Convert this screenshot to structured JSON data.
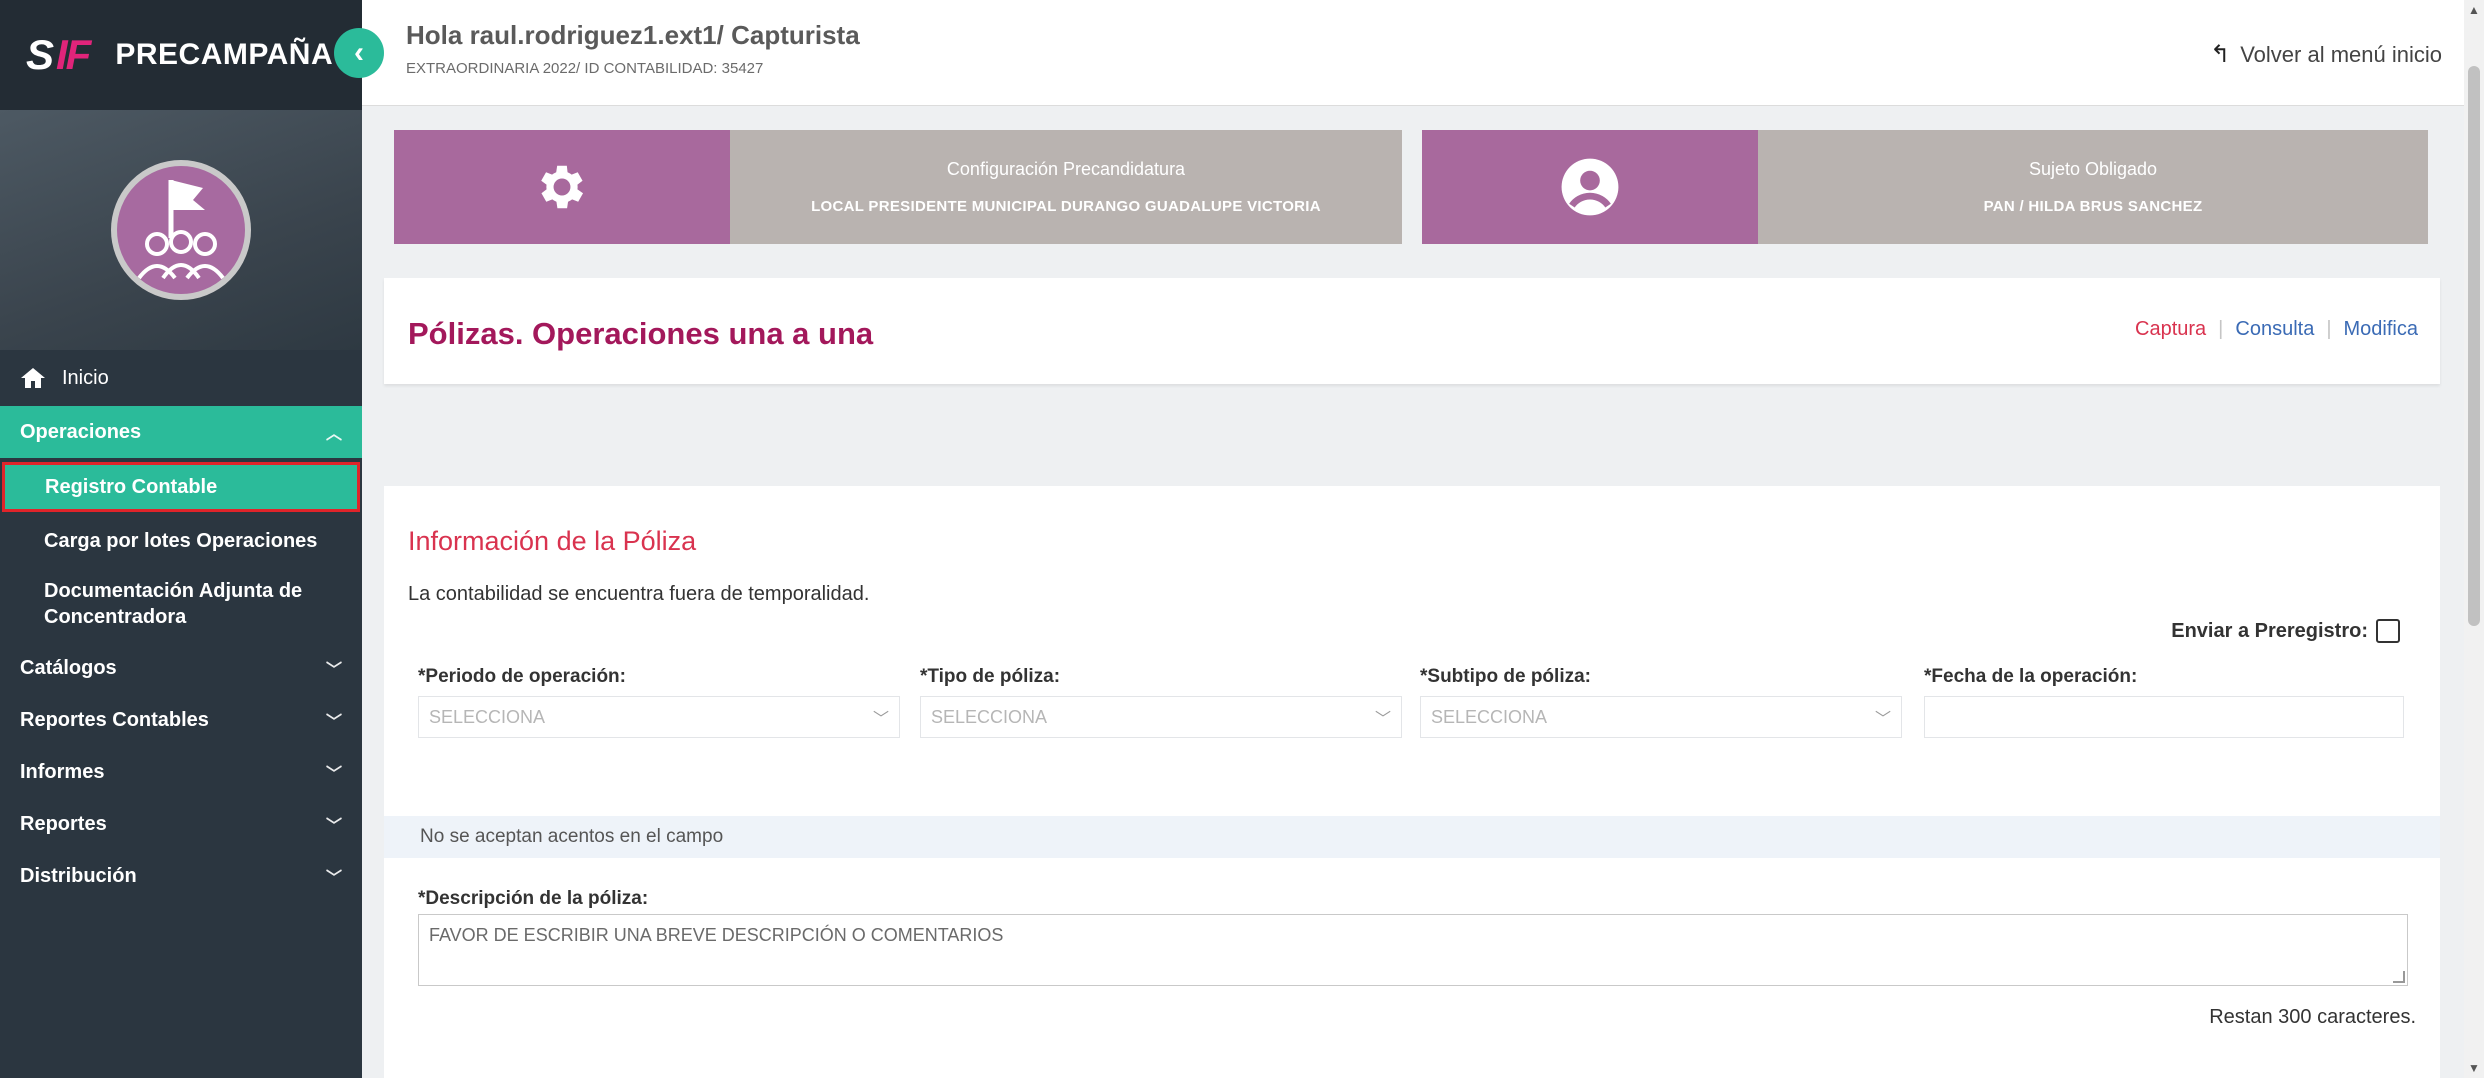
{
  "sidebar": {
    "logo_s": "S",
    "logo_if": "IF",
    "app_title": "PRECAMPAÑA",
    "collapse_icon": "chevron-left-icon",
    "nav": {
      "home": "Inicio",
      "operaciones": "Operaciones",
      "sub_items": [
        "Registro Contable",
        "Carga por lotes Operaciones",
        "Documentación Adjunta de Concentradora"
      ],
      "catalogos": "Catálogos",
      "reportes_contables": "Reportes Contables",
      "informes": "Informes",
      "reportes": "Reportes",
      "distribucion": "Distribución"
    }
  },
  "header": {
    "greeting": "Hola raul.rodriguez1.ext1/ Capturista",
    "subtitle": "EXTRAORDINARIA 2022/ ID CONTABILIDAD: 35427",
    "back_label": "Volver al menú inicio"
  },
  "cards": {
    "config": {
      "icon": "gear-icon",
      "title": "Configuración Precandidatura",
      "value": "LOCAL PRESIDENTE MUNICIPAL DURANGO GUADALUPE VICTORIA"
    },
    "sujeto": {
      "icon": "user-circle-icon",
      "title": "Sujeto Obligado",
      "value": "PAN / HILDA BRUS SANCHEZ"
    }
  },
  "page": {
    "title": "Pólizas. Operaciones una a una",
    "tabs": [
      "Captura",
      "Consulta",
      "Modifica"
    ],
    "active_tab": "Captura"
  },
  "form": {
    "section_title": "Información de la Póliza",
    "notice": "La contabilidad se encuentra fuera de temporalidad.",
    "prereg_label": "Enviar a Preregistro:",
    "fields": {
      "periodo": {
        "label": "*Periodo de operación:",
        "placeholder": "SELECCIONA"
      },
      "tipo": {
        "label": "*Tipo de póliza:",
        "placeholder": "SELECCIONA"
      },
      "subtipo": {
        "label": "*Subtipo de póliza:",
        "placeholder": "SELECCIONA"
      },
      "fecha": {
        "label": "*Fecha de la operación:",
        "value": ""
      }
    },
    "hint": "No se aceptan acentos en el campo",
    "description_label": "*Descripción de la póliza:",
    "description_placeholder": "FAVOR DE ESCRIBIR UNA BREVE DESCRIPCIÓN O COMENTARIOS",
    "counter": "Restan 300 caracteres."
  },
  "colors": {
    "sidebar_bg": "#2b3640",
    "accent_green": "#2bbb9a",
    "card_purple": "#a8699d",
    "card_gray": "#b9b3b0",
    "title_magenta": "#a3185b",
    "section_red": "#d9334f"
  }
}
